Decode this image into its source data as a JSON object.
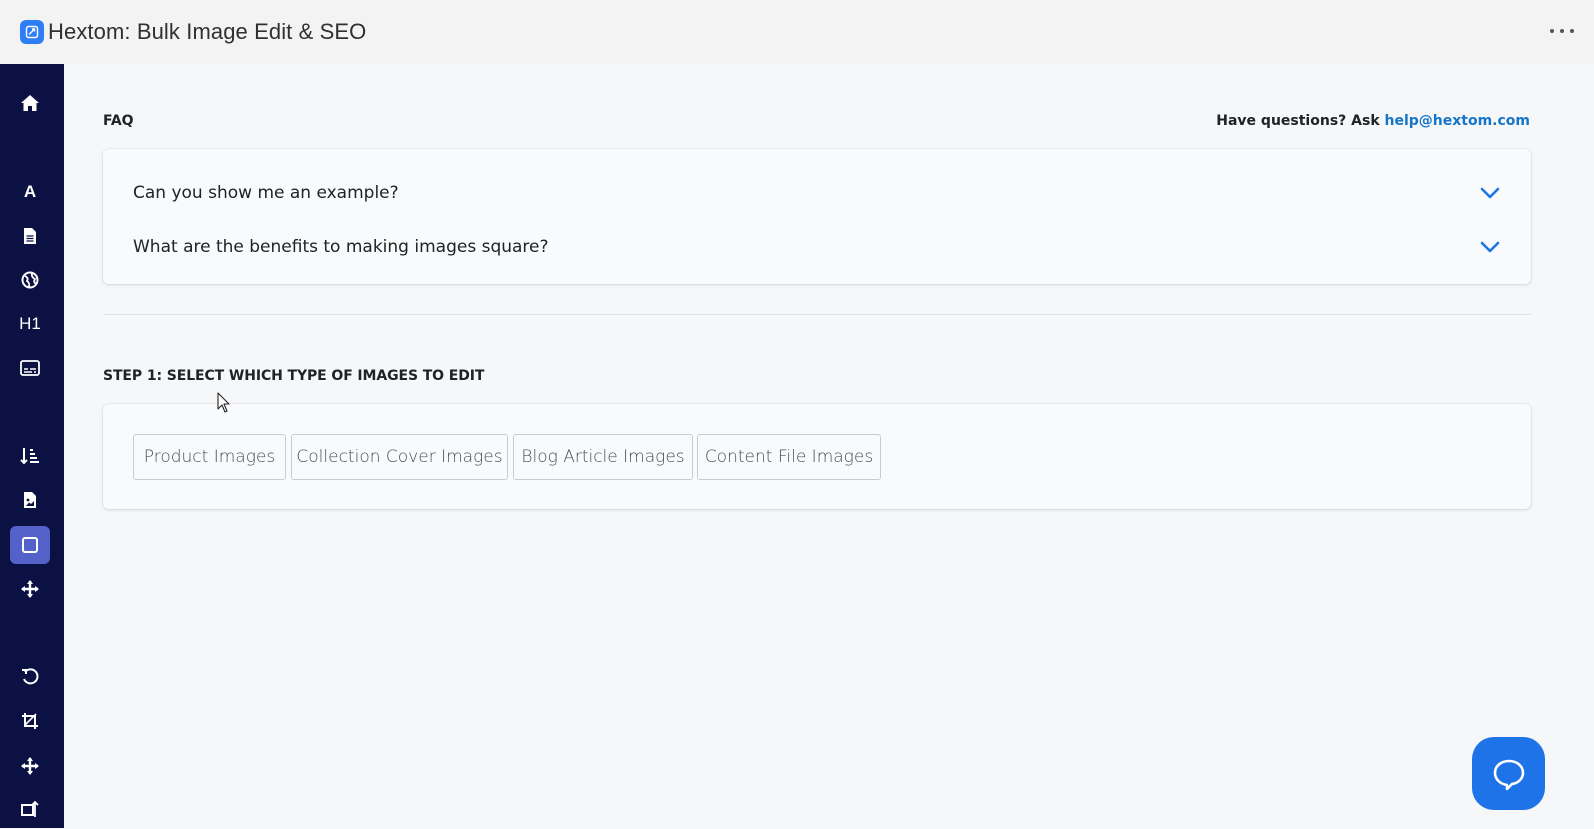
{
  "app": {
    "title": "Hextom: Bulk Image Edit & SEO",
    "logo_icon": "hextom-logo-icon",
    "brand_color": "#2f7df6"
  },
  "sidebar": {
    "background": "#0b1142",
    "active_color": "#5461c8",
    "items": [
      {
        "icon": "home-icon"
      },
      {
        "icon": "font-icon",
        "label": "A"
      },
      {
        "icon": "file-icon"
      },
      {
        "icon": "globe-icon"
      },
      {
        "icon": "heading-icon",
        "label": "H1"
      },
      {
        "icon": "caption-icon"
      },
      {
        "icon": "sort-icon"
      },
      {
        "icon": "image-file-icon"
      },
      {
        "icon": "square-icon",
        "active": true
      },
      {
        "icon": "move-icon"
      },
      {
        "icon": "undo-icon"
      },
      {
        "icon": "crop-icon"
      },
      {
        "icon": "move-icon-2"
      },
      {
        "icon": "resize-icon"
      }
    ]
  },
  "faq": {
    "heading": "FAQ",
    "help_prefix": "Have questions? Ask ",
    "help_email": "help@hextom.com",
    "questions": [
      {
        "text": "Can you show me an example?"
      },
      {
        "text": "What are the benefits to making images square?"
      }
    ]
  },
  "step1": {
    "heading": "STEP 1: SELECT WHICH TYPE OF IMAGES TO EDIT",
    "options": [
      {
        "label": "Product Images"
      },
      {
        "label": "Collection Cover Images"
      },
      {
        "label": "Blog Article Images"
      },
      {
        "label": "Content File Images"
      }
    ]
  },
  "colors": {
    "link": "#1575c9",
    "chat_button": "#1f73e8"
  },
  "chat": {
    "icon": "chat-bubble-icon"
  }
}
